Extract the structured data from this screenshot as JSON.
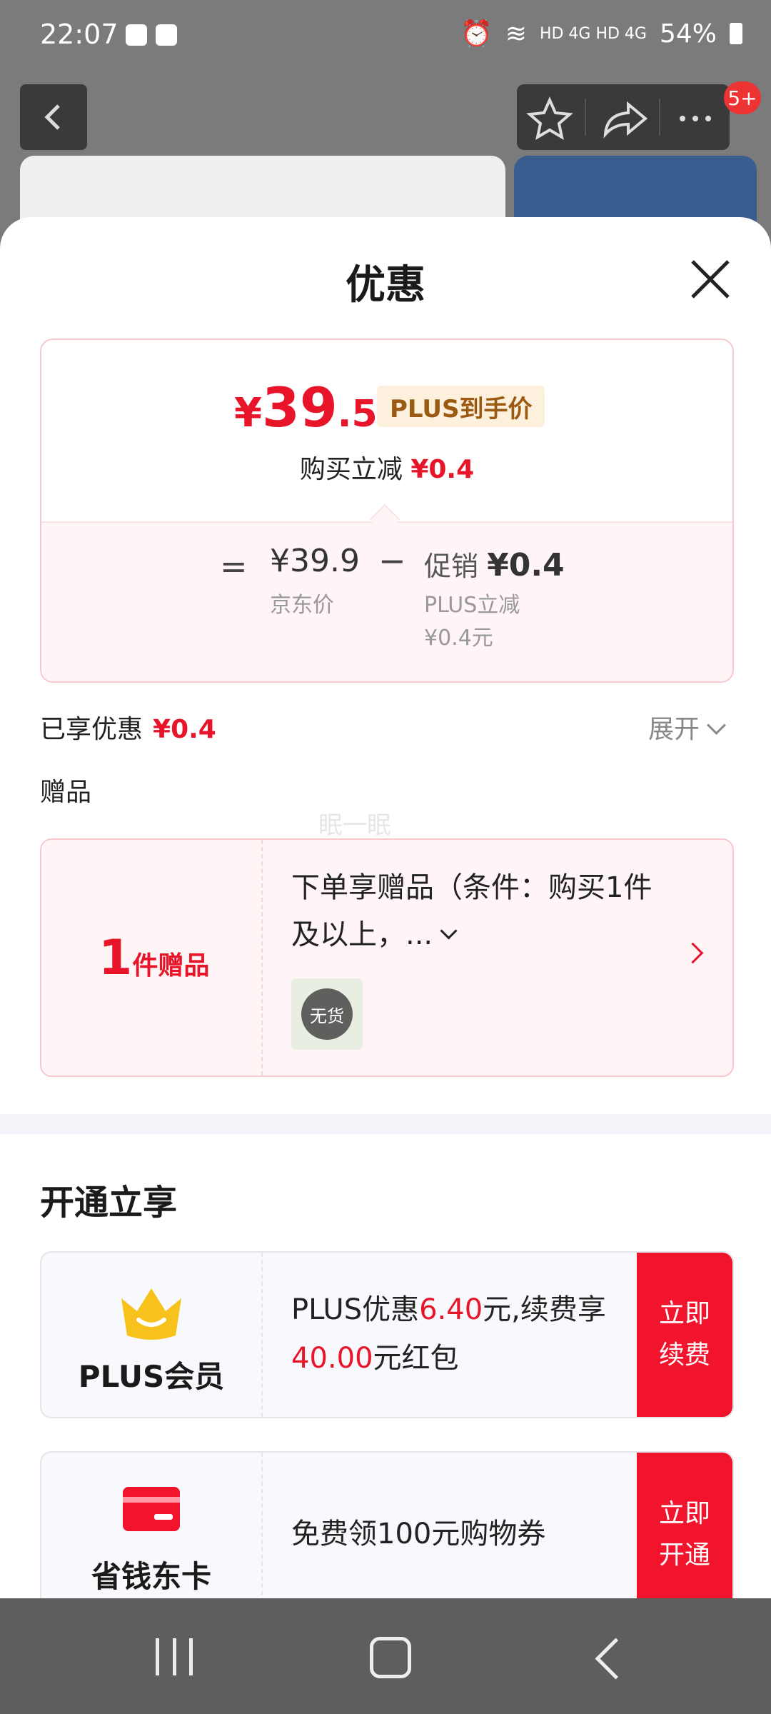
{
  "status_bar": {
    "time": "22:07",
    "network": "HD 4G HD 4G",
    "battery": "54%"
  },
  "header": {
    "badge": "5+"
  },
  "sheet": {
    "title": "优惠",
    "price_box": {
      "price_yen": "¥",
      "price_int": "39",
      "price_dec": ".5",
      "plus_tag": "PLUS到手价",
      "reduce_label": "购买立减",
      "reduce_value": "¥0.4",
      "equals": "=",
      "jd_price": "¥39.9",
      "jd_label": "京东价",
      "minus": "−",
      "promo_label": "促销",
      "promo_value": "¥0.4",
      "promo_sub1": "PLUS立减",
      "promo_sub2": "¥0.4元"
    },
    "enjoyed_label": "已享优惠",
    "enjoyed_value": "¥0.4",
    "expand_label": "展开",
    "gifts_label": "赠品",
    "watermark": "眠一眠",
    "gift": {
      "count": "1",
      "unit": "件赠品",
      "text": "下单享赠品（条件：购买1件及以上，...",
      "sold_out": "无货"
    },
    "open_title": "开通立享",
    "plus_card": {
      "name": "PLUS会员",
      "desc_a": "PLUS优惠",
      "desc_b": "6.40",
      "desc_c": "元,续费享",
      "desc_d": "40.00",
      "desc_e": "元红包",
      "cta_line1": "立即",
      "cta_line2": "续费"
    },
    "card2": {
      "name": "省钱东卡",
      "desc": "免费领100元购物券",
      "cta_line1": "立即",
      "cta_line2": "开通"
    }
  },
  "colors": {
    "accent_red": "#e8142a",
    "cta_red": "#f2142d",
    "plus_gold": "#f8c21c"
  }
}
